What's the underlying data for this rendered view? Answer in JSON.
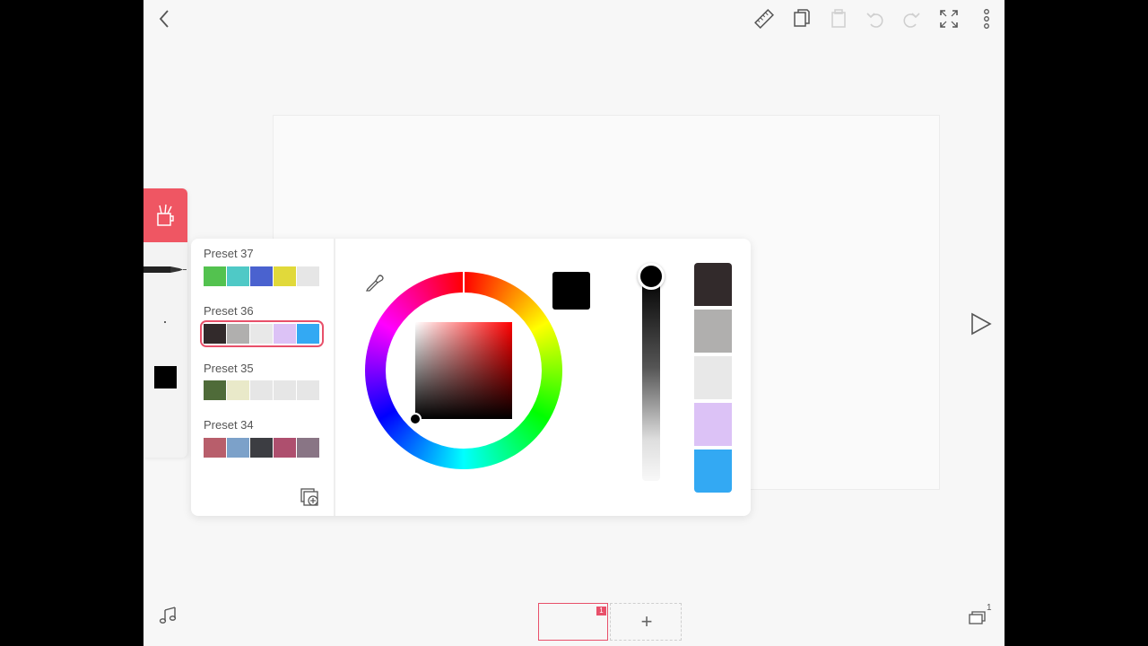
{
  "toolbar": {
    "back": "back-chevron-icon",
    "icons": [
      "ruler-icon",
      "copy-pages-icon",
      "clipboard-icon",
      "undo-icon",
      "redo-icon",
      "fullscreen-icon",
      "more-vertical-icon"
    ]
  },
  "tools": {
    "active_tool": "brush-cup-icon",
    "pen": "pen-tool-icon",
    "brush_size_dot": "dot",
    "current_color": "#000000"
  },
  "color_popup": {
    "presets": [
      {
        "label": "Preset 37",
        "colors": [
          "#53c24f",
          "#4fc9c6",
          "#4a62cf",
          "#e1d93a",
          "#e6e6e6"
        ]
      },
      {
        "label": "Preset 36",
        "colors": [
          "#322a2b",
          "#b0afae",
          "#e8e8e8",
          "#dcc2f6",
          "#33a9f3"
        ],
        "selected": true
      },
      {
        "label": "Preset 35",
        "colors": [
          "#4f6b39",
          "#e9e9c9",
          "#e6e6e6",
          "#e6e6e6",
          "#e6e6e6"
        ]
      },
      {
        "label": "Preset 34",
        "colors": [
          "#b85e6b",
          "#7ca1c9",
          "#3c3d42",
          "#ae4f6e",
          "#897585"
        ]
      }
    ],
    "add_preset_icon": "add-preset-icon",
    "eyedropper_icon": "eyedropper-icon",
    "current_color": "#000000",
    "hue_top": "#ff0000",
    "opacity_level": 1.0,
    "palette": [
      "#322a2b",
      "#b0afae",
      "#e8e8e8",
      "#dcc2f6",
      "#33a9f3"
    ]
  },
  "right_nav": {
    "play": "play-triangle-icon"
  },
  "bottom": {
    "music_icon": "music-note-icon",
    "frame_number": "1",
    "add_frame_label": "+",
    "layers_icon": "layers-icon",
    "layers_count": "1"
  }
}
